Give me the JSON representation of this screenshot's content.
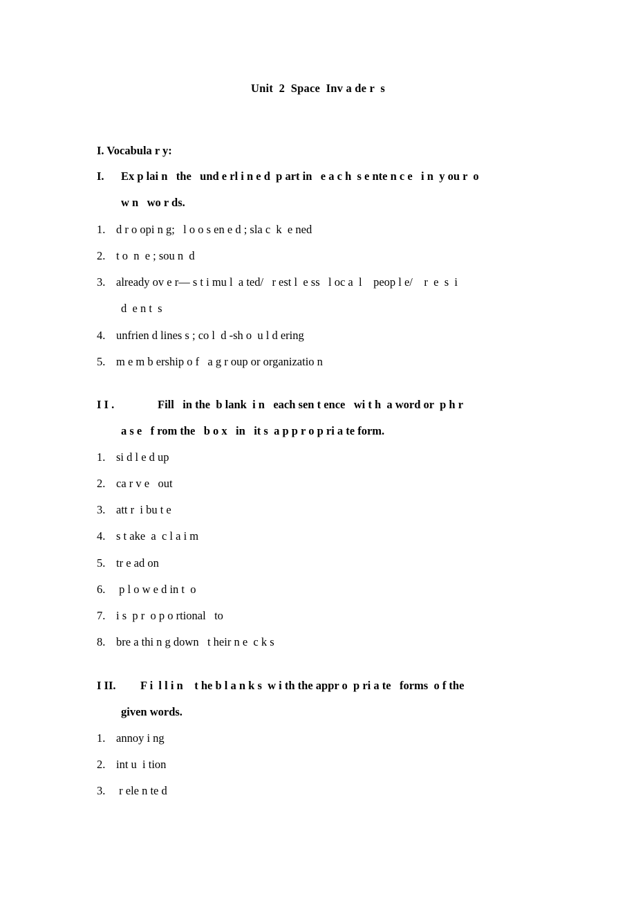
{
  "document": {
    "title": "Unit  2  Space  Inv a de r  s",
    "background_color": "#ffffff",
    "text_color": "#000000"
  },
  "sections": [
    {
      "id": "vocabulary",
      "label": "I. Vocabula r y:",
      "exercises": [
        {
          "id": "exercise-1",
          "numeral": "I.",
          "prompt_line_1": "Ex p lai n   the   und e rl i n e d  p art in   e a c h  s e nte n c e   i n  y ou r  o",
          "prompt_line_2": "w n   wo r ds.",
          "items": [
            {
              "number": "1.",
              "text": "d r o opi n g;   l o o s en e d ; sla c  k  e ned"
            },
            {
              "number": "2.",
              "text": "t o  n  e ; sou n  d"
            },
            {
              "number": "3.",
              "text": "already ov e r— s t i mu l  a ted/   r est l  e ss   l oc a  l    peop l e/    r  e  s  i",
              "continuation": "d  e n t  s"
            },
            {
              "number": "4.",
              "text": "unfrien d lines s ; co l  d -sh o  u l d ering"
            },
            {
              "number": "5.",
              "text": "m e m b ership o f   a g r oup or organizatio n"
            }
          ]
        },
        {
          "id": "exercise-2",
          "numeral": "I I .",
          "prompt_line_1": "Fill   in the  b lank  i n   each sen t ence   wi t h  a word or  p h r",
          "prompt_line_2": "a s e   f rom the   b o x   in   it s  a p p r o p ri a te form.",
          "items": [
            {
              "number": "1.",
              "text": "si d l e d up"
            },
            {
              "number": "2.",
              "text": "ca r v e   out"
            },
            {
              "number": "3.",
              "text": "att r  i bu t e"
            },
            {
              "number": "4.",
              "text": "s t ake  a  c l a i m"
            },
            {
              "number": "5.",
              "text": "tr e ad on"
            },
            {
              "number": "6.",
              "text": " p l o w e d in t  o"
            },
            {
              "number": "7.",
              "text": "i s  p r  o p o rtional   to"
            },
            {
              "number": "8.",
              "text": "bre a thi n g down   t heir n e  c k s"
            }
          ]
        },
        {
          "id": "exercise-3",
          "numeral": "I II.",
          "prompt_line_1": "F i  l l i n    t he b l a n k s  w i th the appr o  p ri a te   forms  o f the",
          "prompt_line_2": "given words.",
          "items": [
            {
              "number": "1.",
              "text": "annoy i ng"
            },
            {
              "number": "2.",
              "text": "int u  i tion"
            },
            {
              "number": "3.",
              "text": " r ele n te d"
            }
          ]
        }
      ]
    }
  ]
}
